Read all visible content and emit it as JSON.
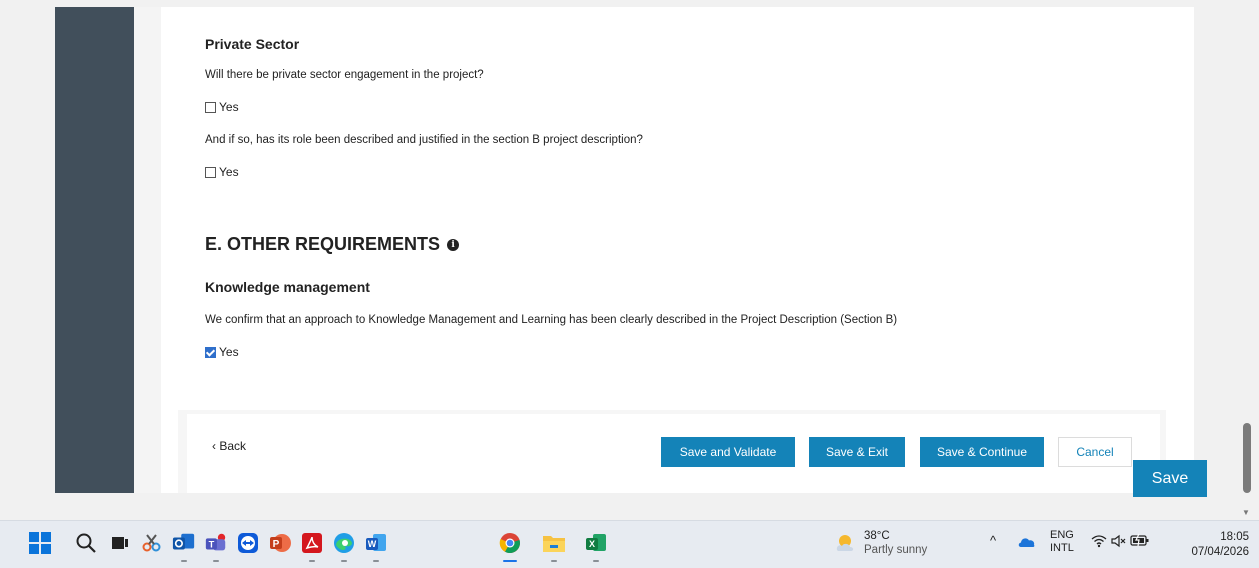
{
  "private_sector": {
    "title": "Private Sector",
    "q1": "Will there be private sector engagement in the project?",
    "q1_option": "Yes",
    "q1_checked": false,
    "q2": "And if so, has its role been described and justified in the section B project description?",
    "q2_option": "Yes",
    "q2_checked": false
  },
  "other_requirements": {
    "heading": "E. OTHER REQUIREMENTS",
    "info_glyph": "i",
    "km_title": "Knowledge management",
    "km_question": "We confirm that an approach to Knowledge Management and Learning has been clearly described in the Project Description (Section B)",
    "km_option": "Yes",
    "km_checked": true
  },
  "footer": {
    "back_label": "‹ Back",
    "save_validate": "Save and Validate",
    "save_exit": "Save & Exit",
    "save_continue": "Save & Continue",
    "cancel": "Cancel",
    "save_float": "Save"
  },
  "taskbar": {
    "icons": [
      "windows-start-icon",
      "search-icon",
      "task-view-icon",
      "snipping-tool-icon",
      "outlook-icon",
      "teams-icon",
      "teamviewer-icon",
      "powerpoint-icon",
      "acrobat-icon",
      "edge-icon",
      "word-icon",
      "chrome-icon",
      "file-explorer-icon",
      "excel-icon"
    ],
    "weather_temp": "38°C",
    "weather_desc": "Partly sunny",
    "lang_top": "ENG",
    "lang_bottom": "INTL",
    "time": "18:05",
    "date": "07/04/2026"
  },
  "colors": {
    "accent": "#1483b8",
    "rail": "#414f5b",
    "checkbox_checked": "#2f6fcb"
  }
}
